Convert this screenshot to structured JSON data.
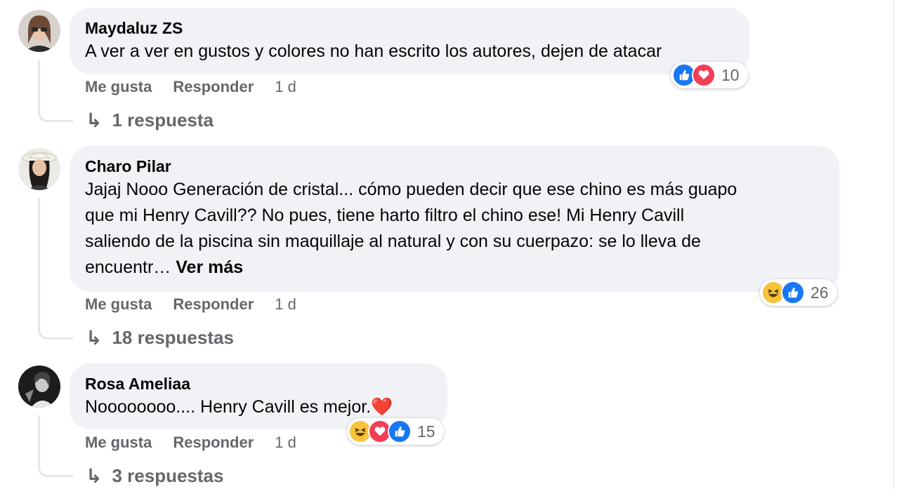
{
  "comments": [
    {
      "author": "Maydaluz ZS",
      "text": "A ver a ver en gustos y colores no han escrito los autores, dejen de atacar",
      "like_label": "Me gusta",
      "reply_label": "Responder",
      "time": "1 d",
      "reaction_count": "10",
      "reactions": [
        "like-icon",
        "love-icon"
      ],
      "replies_label": "1 respuesta"
    },
    {
      "author": "Charo Pilar",
      "text_lines": [
        "Jajaj Nooo Generación de cristal... cómo pueden decir que ese chino es más guapo",
        "que mi Henry Cavill?? No pues, tiene harto filtro el chino ese! Mi Henry Cavill",
        "saliendo de la piscina sin maquillaje al natural y con su cuerpazo: se lo lleva de",
        "encuentr…"
      ],
      "see_more": "Ver más",
      "like_label": "Me gusta",
      "reply_label": "Responder",
      "time": "1 d",
      "reaction_count": "26",
      "reactions": [
        "haha-icon",
        "like-icon"
      ],
      "replies_label": "18 respuestas"
    },
    {
      "author": "Rosa Ameliaa",
      "text": "Noooooooo.... Henry Cavill es mejor.",
      "text_emoji": "❤️",
      "like_label": "Me gusta",
      "reply_label": "Responder",
      "time": "1 d",
      "reaction_count": "15",
      "reactions": [
        "haha-icon",
        "love-icon",
        "like-icon"
      ],
      "replies_label": "3 respuestas"
    }
  ],
  "colors": {
    "bubble": "#f0f2f5",
    "secondary_text": "#65676b",
    "like": "#1877f2",
    "love": "#f33e58",
    "haha": "#f7c33b"
  }
}
